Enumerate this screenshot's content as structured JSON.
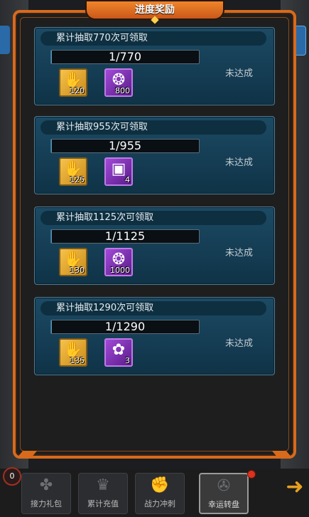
{
  "window": {
    "title": "进度奖励"
  },
  "cards": [
    {
      "title": "累计抽取770次可领取",
      "progress_text": "1/770",
      "progress": 0.0013,
      "status": "未达成",
      "rewards": [
        {
          "icon": "chef-card-icon",
          "glyph": "✋",
          "qty": "120"
        },
        {
          "icon": "green-gem-icon",
          "glyph": "❂",
          "qty": "800"
        }
      ]
    },
    {
      "title": "累计抽取955次可领取",
      "progress_text": "1/955",
      "progress": 0.001,
      "status": "未达成",
      "rewards": [
        {
          "icon": "chef-card-icon",
          "glyph": "✋",
          "qty": "125"
        },
        {
          "icon": "card-pack-icon",
          "glyph": "▣",
          "qty": "4"
        }
      ]
    },
    {
      "title": "累计抽取1125次可领取",
      "progress_text": "1/1125",
      "progress": 0.0009,
      "status": "未达成",
      "rewards": [
        {
          "icon": "chef-card-icon",
          "glyph": "✋",
          "qty": "130"
        },
        {
          "icon": "green-gem-icon",
          "glyph": "❂",
          "qty": "1000"
        }
      ]
    },
    {
      "title": "累计抽取1290次可领取",
      "progress_text": "1/1290",
      "progress": 0.0008,
      "status": "未达成",
      "rewards": [
        {
          "icon": "chef-card-icon",
          "glyph": "✋",
          "qty": "135"
        },
        {
          "icon": "coin-bag-icon",
          "glyph": "✿",
          "qty": "3"
        }
      ]
    }
  ],
  "bottom_tabs": [
    {
      "label": "接力礼包",
      "icon": "gift-icon"
    },
    {
      "label": "累计充值",
      "icon": "crown-icon"
    },
    {
      "label": "战力冲刺",
      "icon": "fist-icon"
    },
    {
      "label": "幸运转盘",
      "icon": "wheel-icon"
    }
  ],
  "left_badge": "0",
  "colors": {
    "accent": "#d86a1c",
    "card_bg": "#1c4a64",
    "status_text": "#c5cdd2"
  }
}
